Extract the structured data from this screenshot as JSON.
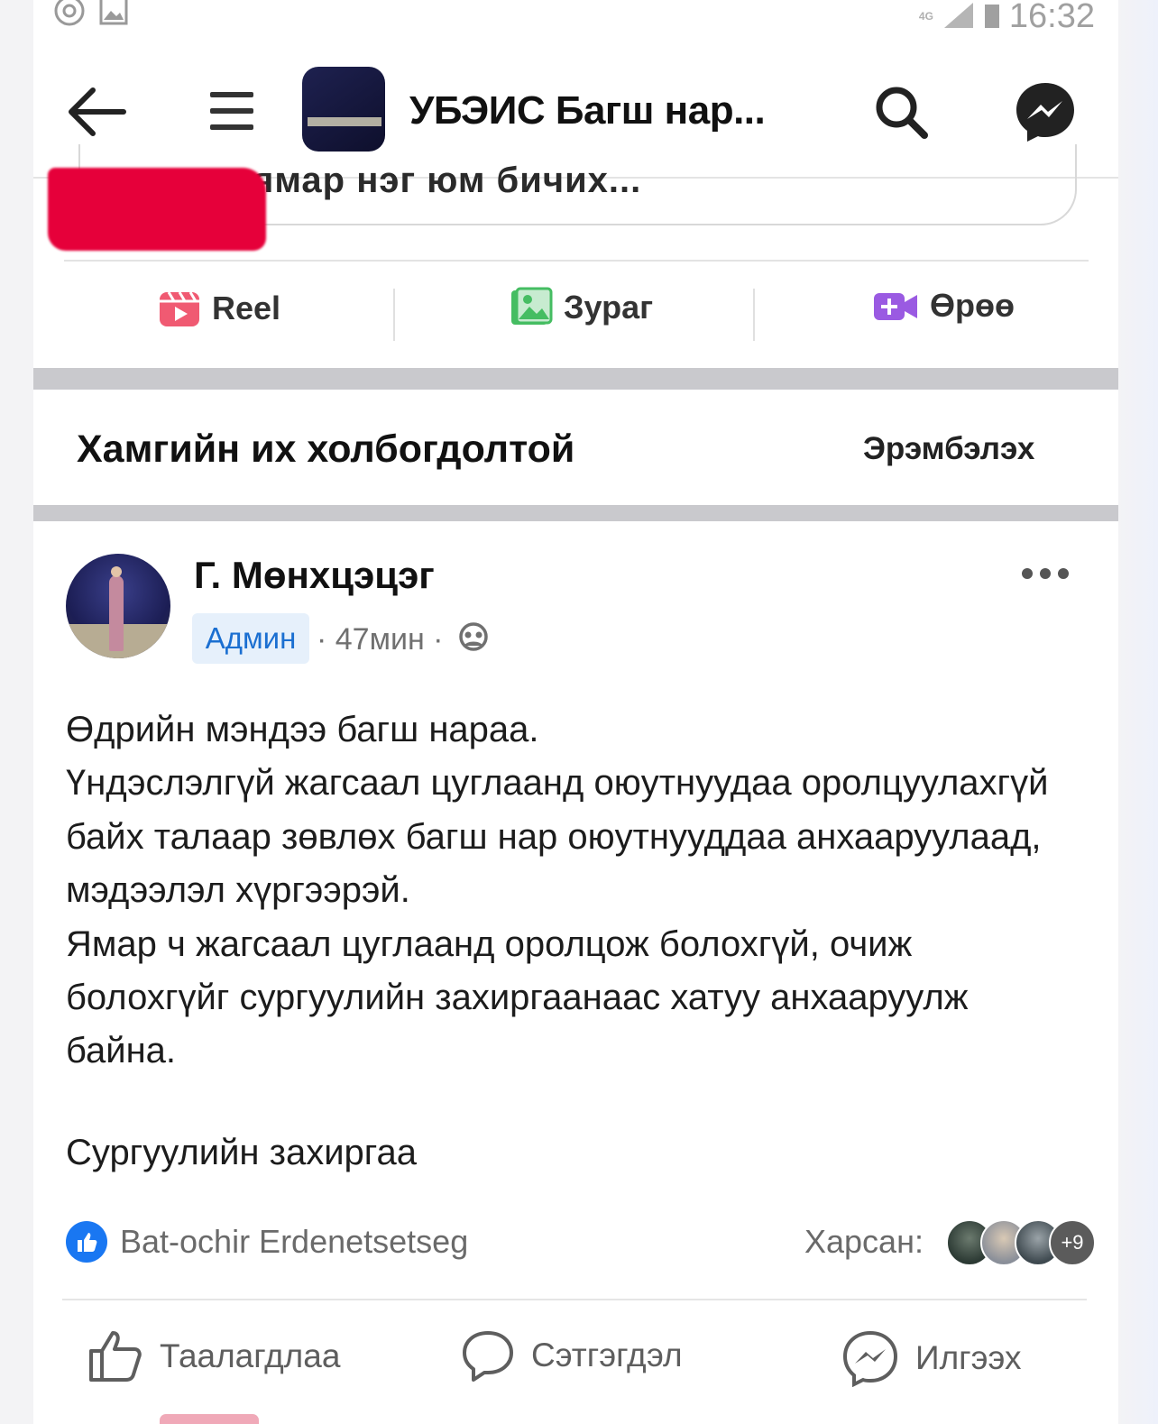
{
  "status_bar": {
    "time": "16:32",
    "network": "4G"
  },
  "header": {
    "title": "УБЭИС Багш нар..."
  },
  "composer": {
    "placeholder_visible": "ямар нэг юм бичих..."
  },
  "actions": [
    {
      "label": "Reel"
    },
    {
      "label": "Зураг"
    },
    {
      "label": "Өрөө"
    }
  ],
  "feed": {
    "section_title": "Хамгийн их холбогдолтой",
    "sort_label": "Эрэмбэлэх"
  },
  "post": {
    "author": "Г. Мөнхцэцэг",
    "role_badge": "Админ",
    "meta": "· 47мин ·",
    "body": "Өдрийн мэндээ багш нараа.\nҮндэслэлгүй жагсаал цуглаанд оюутнуудаа оролцуулахгүй байх талаар зөвлөх багш нар оюутнууддаа анхааруулаад, мэдээлэл хүргээрэй.\nЯмар ч жагсаал цуглаанд оролцож болохгүй, очиж болохгүйг сургуулийн захиргаанаас хатуу анхааруулж байна.",
    "signature": "Сургуулийн захиргаа",
    "liked_by": "Bat-ochir Erdenetsetseg",
    "seen_label": "Харсан:",
    "seen_more": "+9"
  },
  "post_actions": [
    {
      "label": "Таалагдлаа"
    },
    {
      "label": "Сэтгэгдэл"
    },
    {
      "label": "Илгээх"
    }
  ],
  "colors": {
    "accent": "#1977f2",
    "redaction": "#e6003a",
    "separator": "#c9c9cd"
  }
}
